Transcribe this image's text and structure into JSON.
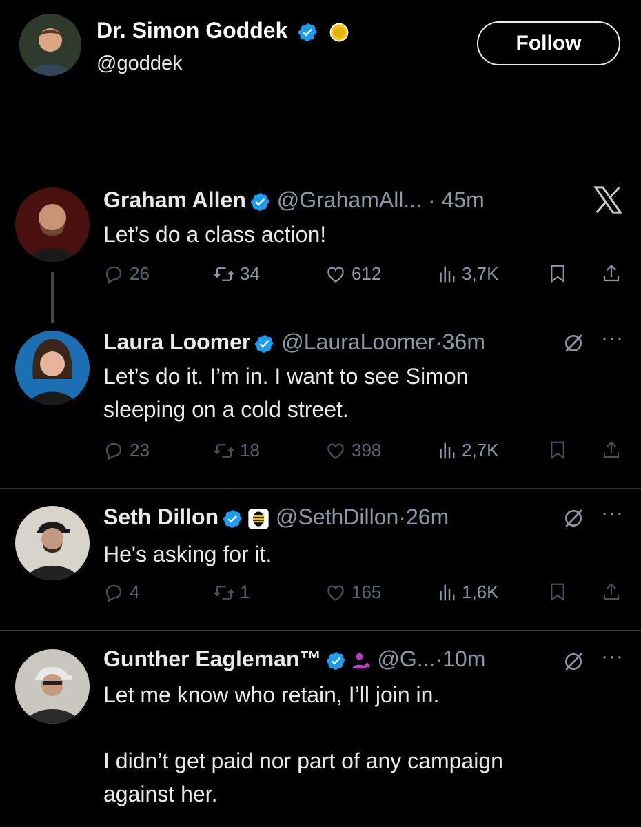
{
  "header": {
    "name": "Dr. Simon Goddek",
    "handle": "@goddek",
    "follow_label": "Follow"
  },
  "tweets": [
    {
      "name": "Graham Allen",
      "handle": "@GrahamAll...",
      "sep": "·",
      "time": "45m",
      "text": "Let’s do a class action!",
      "replies": "26",
      "retweets": "34",
      "likes": "612",
      "views": "3,7K"
    },
    {
      "name": "Laura Loomer",
      "handle": "@LauraLoomer",
      "sep": "·",
      "time": "36m",
      "text": "Let’s do it. I’m in. I want to see Simon\nsleeping on a cold street.",
      "replies": "23",
      "retweets": "18",
      "likes": "398",
      "views": "2,7K"
    },
    {
      "name": "Seth Dillon",
      "handle": "@SethDillon",
      "sep": "·",
      "time": "26m",
      "text": "He's asking for it.",
      "replies": "4",
      "retweets": "1",
      "likes": "165",
      "views": "1,6K"
    },
    {
      "name": "Gunther Eagleman™",
      "handle": "@G...",
      "sep": "·",
      "time": "10m",
      "text": "Let me know who retain, I’ll join in.\n\nI didn’t get paid nor part of any campaign\nagainst her.",
      "replies": "",
      "retweets": "",
      "likes": "",
      "views": ""
    }
  ],
  "colors": {
    "background": "#000000",
    "verified": "#1d9bf0",
    "muted": "#8b98a5",
    "text": "#e7e9ea"
  },
  "icons": [
    "verified-badge-icon",
    "gold-coin-icon",
    "x-logo-icon",
    "reply-icon",
    "retweet-icon",
    "like-icon",
    "views-icon",
    "bookmark-icon",
    "share-icon",
    "grok-icon",
    "more-icon",
    "affiliate-badge-icon",
    "person-star-icon"
  ]
}
